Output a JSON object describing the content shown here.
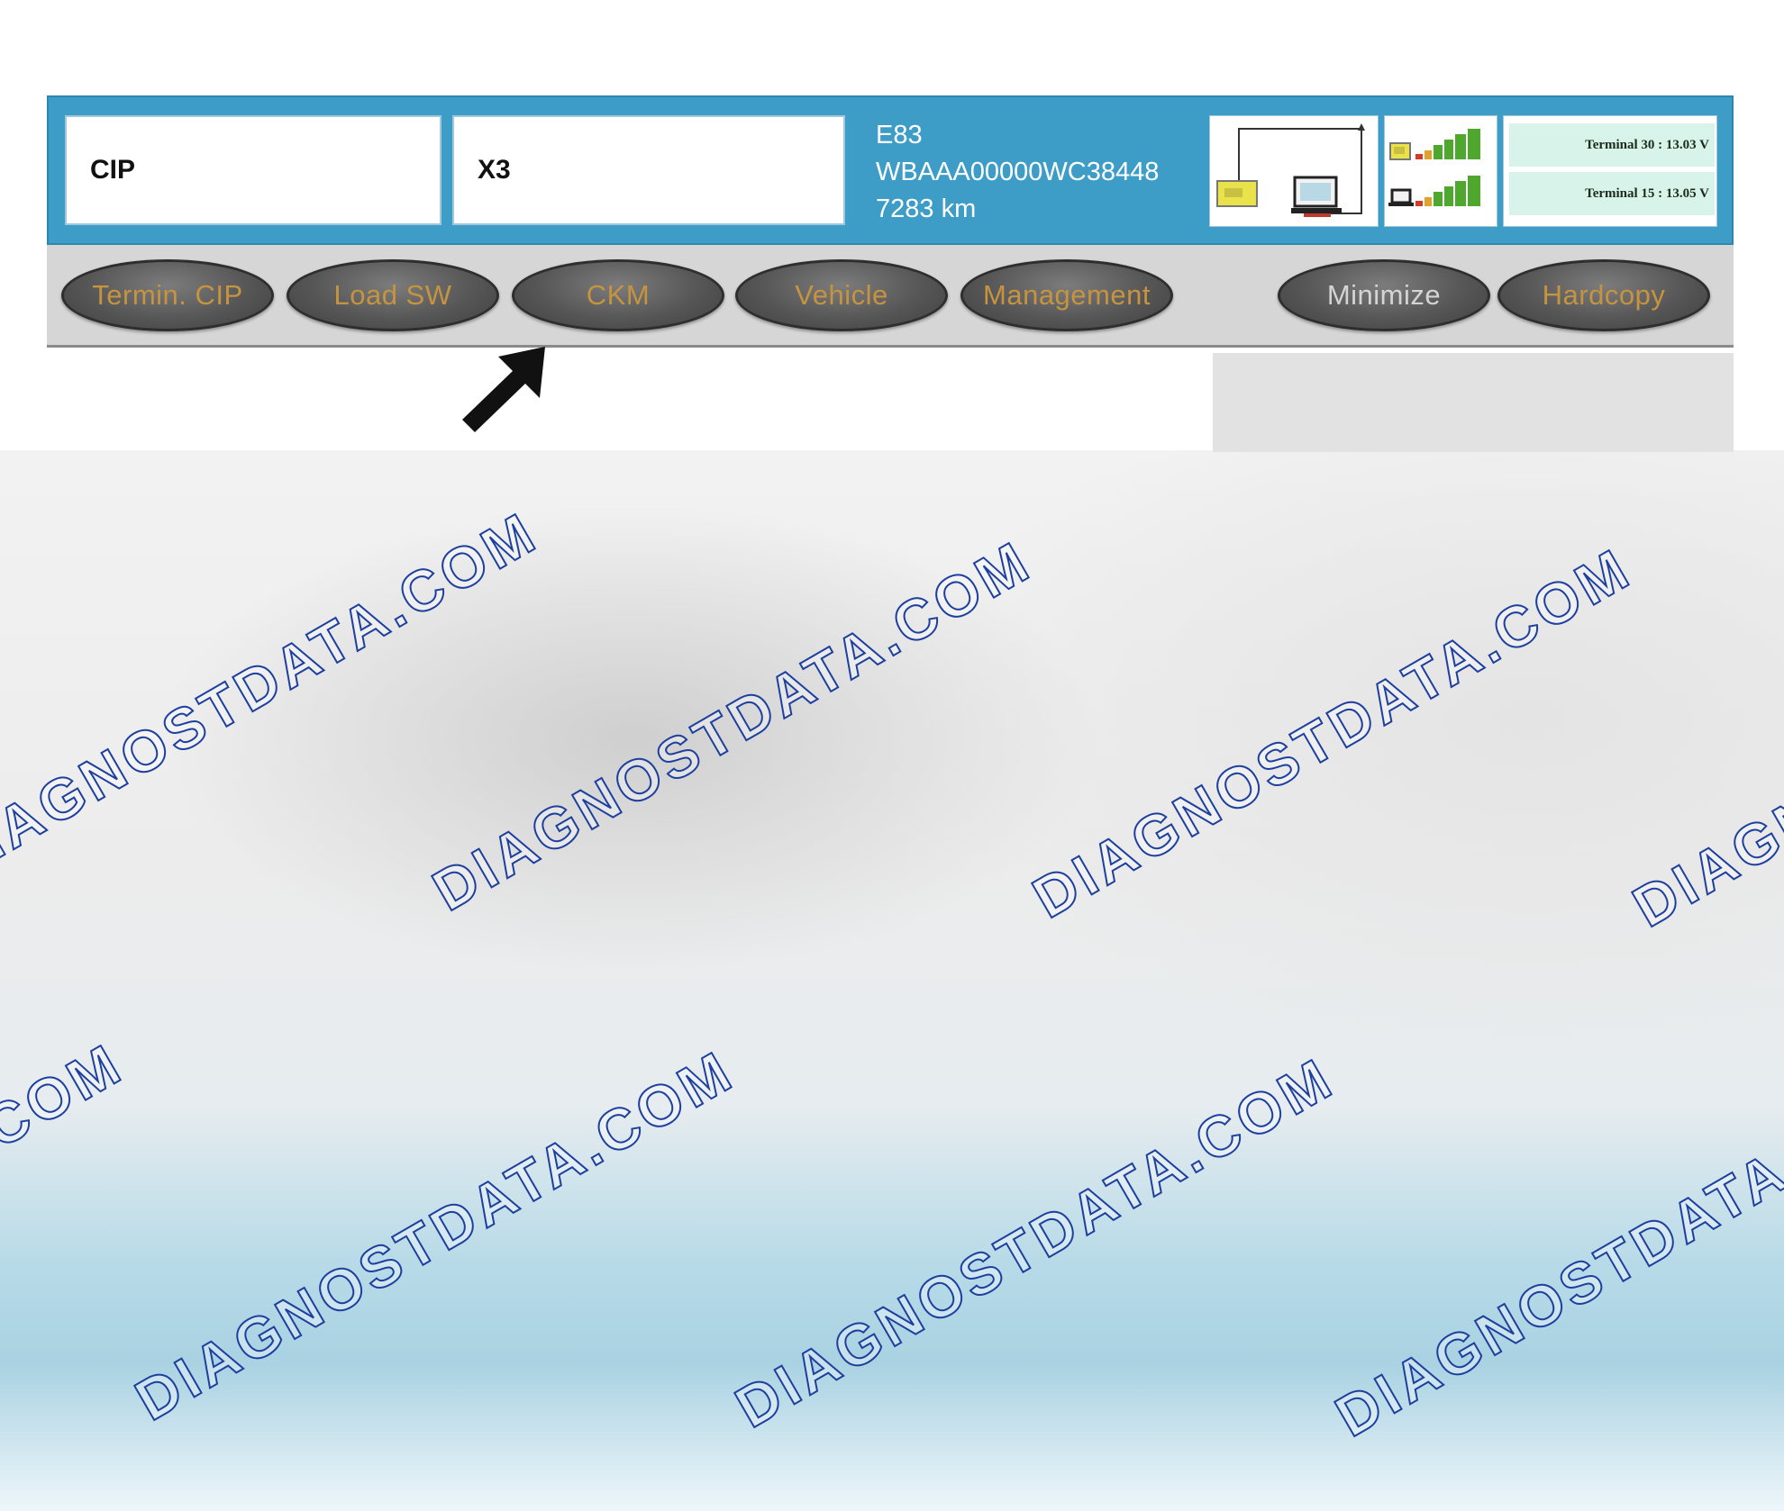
{
  "header": {
    "field1": "CIP",
    "field2": "X3",
    "vehicle_model": "E83",
    "vin": "WBAAA00000WC38448",
    "mileage": "7283 km",
    "terminal_30": "Terminal 30 : 13.03 V",
    "terminal_15": "Terminal 15 : 13.05 V"
  },
  "toolbar": {
    "buttons": [
      "Termin. CIP",
      "Load SW",
      "CKM",
      "Vehicle",
      "Management"
    ],
    "minimize": "Minimize",
    "hardcopy": "Hardcopy"
  },
  "watermark": "DIAGNOSTDATA.COM",
  "colors": {
    "header_bg": "#3d9dc7",
    "toolbar_bg": "#d6d6d6",
    "button_text": "#c6933f",
    "watermark_stroke": "#1d3f9e"
  },
  "icons": [
    "connection-diagram-icon",
    "signal-strength-icon",
    "pointer-arrow-icon"
  ]
}
